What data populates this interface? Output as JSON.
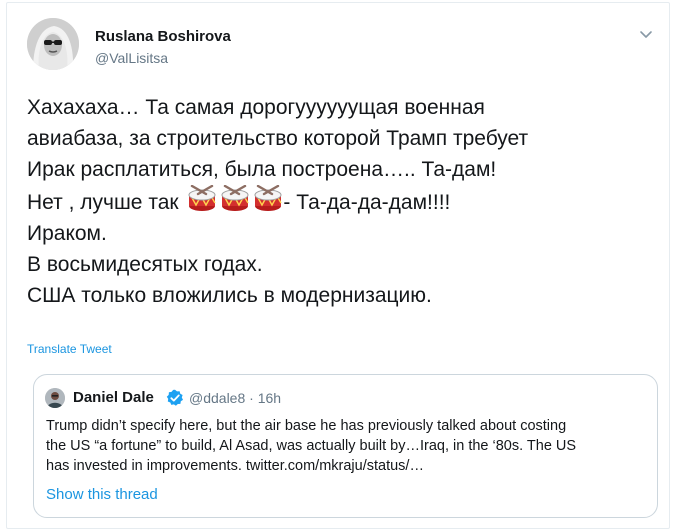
{
  "tweet": {
    "author_name": "Ruslana Boshirova",
    "author_handle": "@ValLisitsa",
    "text_lines": [
      "Хахахаха… Та самая дорогуууууущая военная",
      "авиабаза, за строительство которой Трамп требует",
      "Ирак расплатиться, была построена….. Та-дам!",
      "Нет , лучше так",
      "- Та-да-да-дам!!!!",
      "Ираком.",
      "В восьмидесятых годах.",
      "США только вложились в модернизацию."
    ],
    "drum_emoji_count": 3,
    "translate_label": "Translate Tweet"
  },
  "quoted_tweet": {
    "author_name": "Daniel Dale",
    "author_handle": "@ddale8",
    "separator": "·",
    "time": "16h",
    "text_lines": [
      "Trump didn’t specify here, but the air base he has previously talked about costing",
      "the US “a fortune” to build, Al Asad, was actually built by…Iraq, in the ‘80s. The US",
      "has invested in improvements. twitter.com/mkraju/status/…"
    ],
    "show_thread_label": "Show this thread"
  },
  "colors": {
    "text_primary": "#14171a",
    "text_secondary": "#657786",
    "link": "#1b95e0",
    "border": "#e6ecf0",
    "quote_border": "#ccd6dd",
    "verified": "#1da1f2"
  },
  "icons": {
    "caret": "chevron-down-icon",
    "verified": "verified-badge-icon",
    "emoji": "drum-emoji"
  }
}
